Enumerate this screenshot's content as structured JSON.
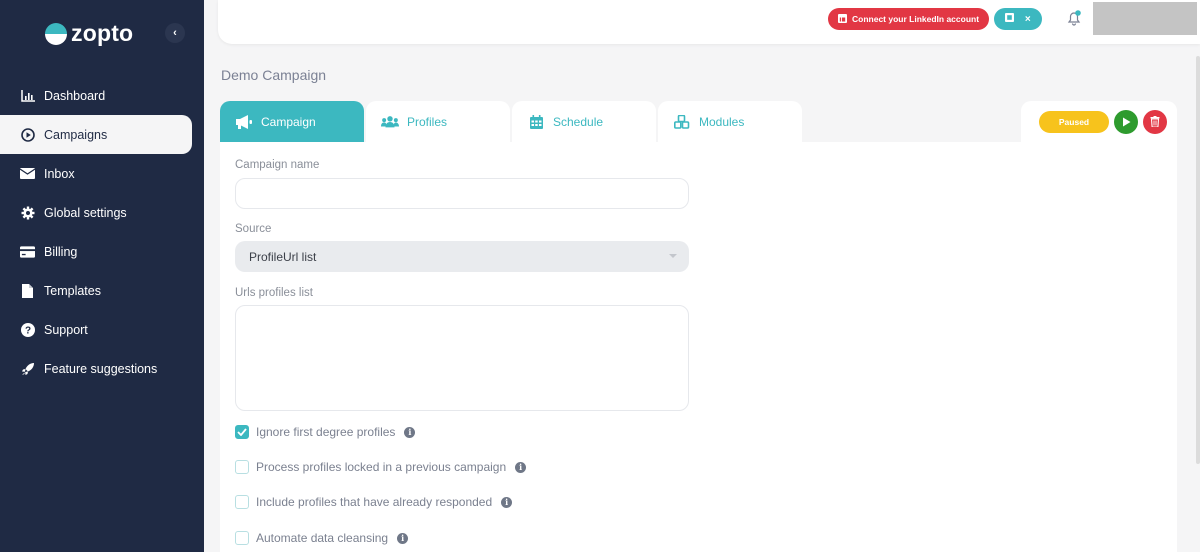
{
  "app": {
    "brand": "zopto",
    "brand_mark": "z",
    "collapse_icon": "‹"
  },
  "sidebar": {
    "items": [
      {
        "label": "Dashboard",
        "icon": "chart-bar-icon",
        "active": false
      },
      {
        "label": "Campaigns",
        "icon": "play-circle-icon",
        "active": true
      },
      {
        "label": "Inbox",
        "icon": "envelope-icon",
        "active": false
      },
      {
        "label": "Global settings",
        "icon": "gear-icon",
        "active": false
      },
      {
        "label": "Billing",
        "icon": "credit-card-icon",
        "active": false
      },
      {
        "label": "Templates",
        "icon": "file-icon",
        "active": false
      },
      {
        "label": "Support",
        "icon": "question-circle-icon",
        "active": false
      },
      {
        "label": "Feature suggestions",
        "icon": "rocket-icon",
        "active": false
      }
    ]
  },
  "topbar": {
    "connect_label": "Connect your LinkedIn account",
    "ext_close": "×"
  },
  "page": {
    "title": "Demo Campaign"
  },
  "tabs": [
    {
      "label": "Campaign",
      "icon": "megaphone-icon",
      "active": true
    },
    {
      "label": "Profiles",
      "icon": "users-icon",
      "active": false
    },
    {
      "label": "Schedule",
      "icon": "calendar-icon",
      "active": false
    },
    {
      "label": "Modules",
      "icon": "cubes-icon",
      "active": false
    }
  ],
  "actions": {
    "status": "Paused"
  },
  "form": {
    "campaign_name": {
      "label": "Campaign name",
      "value": ""
    },
    "source": {
      "label": "Source",
      "value": "ProfileUrl list"
    },
    "urls": {
      "label": "Urls profiles list",
      "value": ""
    },
    "checkboxes": [
      {
        "label": "Ignore first degree profiles",
        "checked": true
      },
      {
        "label": "Process profiles locked in a previous campaign",
        "checked": false
      },
      {
        "label": "Include profiles that have already responded",
        "checked": false
      },
      {
        "label": "Automate data cleansing",
        "checked": false
      }
    ],
    "info_glyph": "i"
  },
  "colors": {
    "accent": "#3cb8c0",
    "sidebar": "#1f2a44",
    "danger": "#e23744",
    "warning": "#f7c31c",
    "success": "#2e9b2e"
  }
}
